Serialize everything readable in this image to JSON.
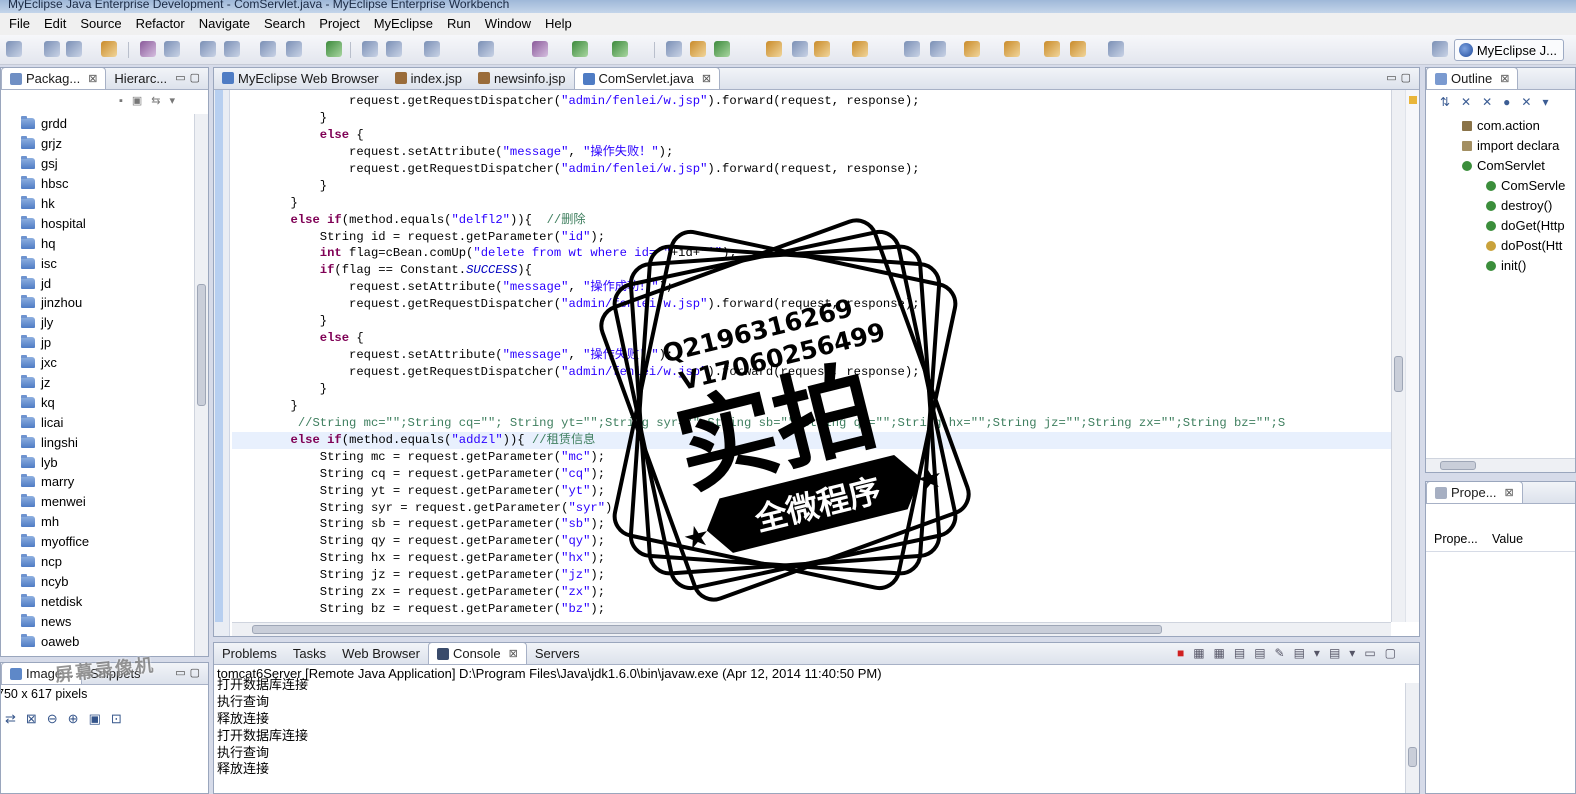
{
  "window_title": "MyEclipse Java Enterprise Development - ComServlet.java - MyEclipse Enterprise Workbench",
  "menu": [
    "File",
    "Edit",
    "Source",
    "Refactor",
    "Navigate",
    "Search",
    "Project",
    "MyEclipse",
    "Run",
    "Window",
    "Help"
  ],
  "perspective_label": "MyEclipse J...",
  "left_panel": {
    "tabs": [
      "Packag...",
      "Hierarc..."
    ],
    "folders": [
      "grdd",
      "grjz",
      "gsj",
      "hbsc",
      "hk",
      "hospital",
      "hq",
      "isc",
      "jd",
      "jinzhou",
      "jly",
      "jp",
      "jxc",
      "jz",
      "kq",
      "licai",
      "lingshi",
      "lyb",
      "marry",
      "menwei",
      "mh",
      "myoffice",
      "ncp",
      "ncyb",
      "netdisk",
      "news",
      "oaweb"
    ]
  },
  "image_panel": {
    "tabs": [
      "Image...",
      "Snippets"
    ],
    "info": "750 x 617 pixels"
  },
  "editor": {
    "tabs": [
      "MyEclipse Web Browser",
      "index.jsp",
      "newsinfo.jsp",
      "ComServlet.java"
    ],
    "active_tab": "ComServlet.java",
    "lines": [
      "                request.getRequestDispatcher(\"admin/fenlei/w.jsp\").forward(request, response);",
      "            }",
      "            else {",
      "                request.setAttribute(\"message\", \"操作失败！\");",
      "                request.getRequestDispatcher(\"admin/fenlei/w.jsp\").forward(request, response);",
      "            }",
      "        }",
      "        else if(method.equals(\"delfl2\")){  //删除",
      "            String id = request.getParameter(\"id\");",
      "            int flag=cBean.comUp(\"delete from wt where id='\"+id+\"'\");",
      "            if(flag == Constant.SUCCESS){",
      "                request.setAttribute(\"message\", \"操作成功！\");",
      "                request.getRequestDispatcher(\"admin/fenlei/w.jsp\").forward(request, response);",
      "            }",
      "            else {",
      "                request.setAttribute(\"message\", \"操作失败！\");",
      "                request.getRequestDispatcher(\"admin/fenlei/w.jsp\").forward(request, response);",
      "            }",
      "        }",
      "         //String mc=\"\";String cq=\"\"; String yt=\"\";String syr=\"\";String sb=\"\";String qy=\"\";String hx=\"\";String jz=\"\";String zx=\"\";String bz=\"\";S",
      "        else if(method.equals(\"addzl\")){ //租赁信息",
      "            String mc = request.getParameter(\"mc\");",
      "            String cq = request.getParameter(\"cq\");",
      "            String yt = request.getParameter(\"yt\");",
      "            String syr = request.getParameter(\"syr\");",
      "            String sb = request.getParameter(\"sb\");",
      "            String qy = request.getParameter(\"qy\");",
      "            String hx = request.getParameter(\"hx\");",
      "            String jz = request.getParameter(\"jz\");",
      "            String zx = request.getParameter(\"zx\");",
      "            String bz = request.getParameter(\"bz\");"
    ]
  },
  "outline": {
    "tab": "Outline",
    "items": [
      "com.action",
      "import declara",
      "ComServlet",
      "ComServle",
      "destroy()",
      "doGet(Http",
      "doPost(Htt",
      "init()"
    ]
  },
  "properties": {
    "tab": "Prope...",
    "col_property": "Prope...",
    "col_value": "Value"
  },
  "console": {
    "tabs": [
      "Problems",
      "Tasks",
      "Web Browser",
      "Console",
      "Servers"
    ],
    "active_tab": "Console",
    "header": "tomcat6Server [Remote Java Application] D:\\Program Files\\Java\\jdk1.6.0\\bin\\javaw.exe (Apr 12, 2014 11:40:50 PM)",
    "lines": [
      "打开数据库连接",
      "执行查询",
      "释放连接",
      "打开数据库连接",
      "执行查询",
      "释放连接"
    ]
  },
  "stamp": {
    "qq": "Q2196316269",
    "wechat": "V17060256499",
    "title": "实拍",
    "subtitle": "全微程序"
  },
  "recorder_watermark": "屏幕录像机"
}
